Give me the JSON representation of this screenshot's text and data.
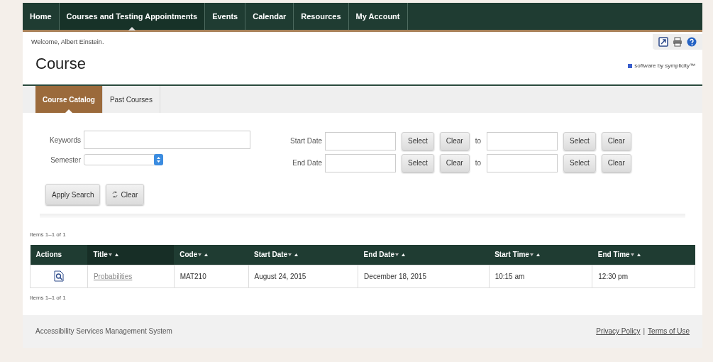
{
  "nav": [
    {
      "label": "Home",
      "selected": false
    },
    {
      "label": "Courses and Testing Appointments",
      "selected": true
    },
    {
      "label": "Events",
      "selected": false
    },
    {
      "label": "Calendar",
      "selected": false
    },
    {
      "label": "Resources",
      "selected": false
    },
    {
      "label": "My Account",
      "selected": false
    }
  ],
  "welcome": "Welcome, Albert Einstein.",
  "page_title": "Course",
  "brand": "software by symplicity™",
  "tabs": [
    {
      "label": "Course Catalog",
      "selected": true
    },
    {
      "label": "Past Courses",
      "selected": false
    }
  ],
  "search": {
    "keywords_label": "Keywords",
    "semester_label": "Semester",
    "date_rows": [
      {
        "label": "Start Date",
        "select": "Select",
        "clear": "Clear",
        "to": "to",
        "select2": "Select",
        "clear2": "Clear"
      },
      {
        "label": "End Date",
        "select": "Select",
        "clear": "Clear",
        "to": "to",
        "select2": "Select",
        "clear2": "Clear"
      }
    ],
    "apply_button": "Apply Search",
    "clear_button": "Clear"
  },
  "count_top": "Items 1–1 of 1",
  "table": {
    "columns": [
      {
        "label": "Actions",
        "sortable": false
      },
      {
        "label": "Title",
        "sortable": true
      },
      {
        "label": "Code",
        "sortable": true
      },
      {
        "label": "Start Date",
        "sortable": true
      },
      {
        "label": "End Date",
        "sortable": true
      },
      {
        "label": "Start Time",
        "sortable": true
      },
      {
        "label": "End Time",
        "sortable": true
      }
    ],
    "rows": [
      {
        "title": "Probabilities",
        "code": "MAT210",
        "start_date": "August 24, 2015",
        "end_date": "December 18, 2015",
        "start_time": "10:15 am",
        "end_time": "12:30 pm"
      }
    ]
  },
  "count_bottom": "Items 1–1 of 1",
  "footer": {
    "system": "Accessibility Services Management System",
    "links": [
      "Privacy Policy",
      "Terms of Use"
    ],
    "separator": "|"
  }
}
